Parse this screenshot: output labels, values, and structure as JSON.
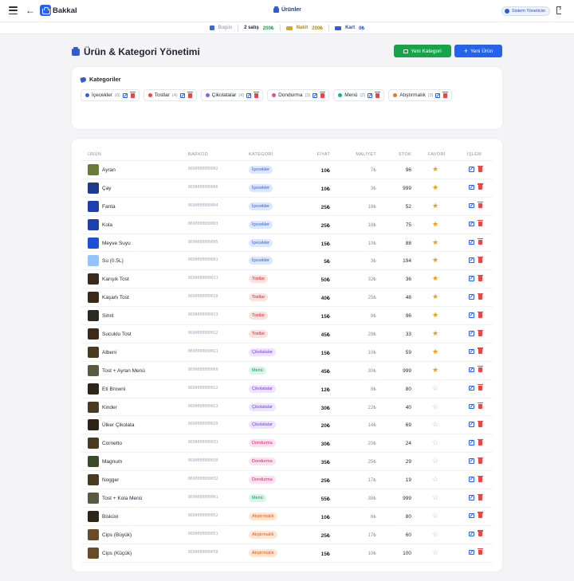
{
  "app": {
    "brand": "Bakkal",
    "section_title": "Ürünler",
    "user_label": "Sistem Yöneticisi"
  },
  "stats": {
    "today_label": "Bugün",
    "sales_count": "2 satış",
    "total": "200₺",
    "cash_label": "Nakit",
    "cash_value": "200₺",
    "card_label": "Kart",
    "card_value": "0₺"
  },
  "page": {
    "title": "Ürün & Kategori Yönetimi",
    "new_category": "Yeni Kategori",
    "new_product": "Yeni Ürün"
  },
  "categories": {
    "title": "Kategoriler",
    "items": [
      {
        "label": "İçecekler",
        "count": "(6)",
        "color": "#2563eb"
      },
      {
        "label": "Tostlar",
        "count": "(4)",
        "color": "#ef4444"
      },
      {
        "label": "Çikolatalar",
        "count": "(4)",
        "color": "#8b5cf6"
      },
      {
        "label": "Dondurma",
        "count": "(3)",
        "color": "#ec4899"
      },
      {
        "label": "Menü",
        "count": "(2)",
        "color": "#10b981"
      },
      {
        "label": "Atıştırmalık",
        "count": "(3)",
        "color": "#f97316"
      }
    ]
  },
  "table": {
    "headers": [
      "ÜRÜN",
      "BARKOD",
      "KATEGORİ",
      "FİYAT",
      "MALİYET",
      "STOK",
      "FAVORİ",
      "İŞLEM"
    ],
    "rows": [
      {
        "name": "Ayran",
        "barcode": "8690000000002",
        "category": "İçecekler",
        "cat": "icecek",
        "price": "10₺",
        "cost": "7₺",
        "stock": "96",
        "fav": true,
        "thumb": "#6b7b3a"
      },
      {
        "name": "Çay",
        "barcode": "8690000000006",
        "category": "İçecekler",
        "cat": "icecek",
        "price": "10₺",
        "cost": "3₺",
        "stock": "999",
        "fav": true,
        "thumb": "#1e3a8a"
      },
      {
        "name": "Fanta",
        "barcode": "8690000000004",
        "category": "İçecekler",
        "cat": "icecek",
        "price": "25₺",
        "cost": "18₺",
        "stock": "52",
        "fav": true,
        "thumb": "#1e40af"
      },
      {
        "name": "Kola",
        "barcode": "8690000000003",
        "category": "İçecekler",
        "cat": "icecek",
        "price": "25₺",
        "cost": "18₺",
        "stock": "75",
        "fav": true,
        "thumb": "#1e40af"
      },
      {
        "name": "Meyve Suyu",
        "barcode": "8690000000005",
        "category": "İçecekler",
        "cat": "icecek",
        "price": "15₺",
        "cost": "10₺",
        "stock": "88",
        "fav": true,
        "thumb": "#1d4ed8"
      },
      {
        "name": "Su (0.5L)",
        "barcode": "8690000000001",
        "category": "İçecekler",
        "cat": "icecek",
        "price": "5₺",
        "cost": "3₺",
        "stock": "194",
        "fav": true,
        "thumb": "#93c5fd"
      },
      {
        "name": "Karışık Tost",
        "barcode": "8690000000011",
        "category": "Tostlar",
        "cat": "tost",
        "price": "50₺",
        "cost": "32₺",
        "stock": "36",
        "fav": true,
        "thumb": "#3b2a1a"
      },
      {
        "name": "Kaşarlı Tost",
        "barcode": "8690000000010",
        "category": "Tostlar",
        "cat": "tost",
        "price": "40₺",
        "cost": "25₺",
        "stock": "48",
        "fav": true,
        "thumb": "#3b2a1a"
      },
      {
        "name": "Simit",
        "barcode": "8690000000013",
        "category": "Tostlar",
        "cat": "tost",
        "price": "15₺",
        "cost": "8₺",
        "stock": "96",
        "fav": true,
        "thumb": "#2a2a22"
      },
      {
        "name": "Sucuklu Tost",
        "barcode": "8690000000012",
        "category": "Tostlar",
        "cat": "tost",
        "price": "45₺",
        "cost": "28₺",
        "stock": "33",
        "fav": true,
        "thumb": "#3b2a1a"
      },
      {
        "name": "Albeni",
        "barcode": "8690000000021",
        "category": "Çikolatalar",
        "cat": "cikolata",
        "price": "15₺",
        "cost": "10₺",
        "stock": "59",
        "fav": true,
        "thumb": "#4a3a22"
      },
      {
        "name": "Tost + Ayran Menü",
        "barcode": "8690000000060",
        "category": "Menü",
        "cat": "menu",
        "price": "45₺",
        "cost": "30₺",
        "stock": "999",
        "fav": true,
        "thumb": "#5a5a40"
      },
      {
        "name": "Eti Browni",
        "barcode": "8690000000022",
        "category": "Çikolatalar",
        "cat": "cikolata",
        "price": "12₺",
        "cost": "8₺",
        "stock": "80",
        "fav": false,
        "thumb": "#2f2418"
      },
      {
        "name": "Kinder",
        "barcode": "8690000000023",
        "category": "Çikolatalar",
        "cat": "cikolata",
        "price": "30₺",
        "cost": "22₺",
        "stock": "40",
        "fav": false,
        "thumb": "#4a3a22"
      },
      {
        "name": "Ülker Çikolata",
        "barcode": "8690000000020",
        "category": "Çikolatalar",
        "cat": "cikolata",
        "price": "20₺",
        "cost": "14₺",
        "stock": "69",
        "fav": false,
        "thumb": "#2f2418"
      },
      {
        "name": "Cornetto",
        "barcode": "8690000000031",
        "category": "Dondurma",
        "cat": "dondurma",
        "price": "30₺",
        "cost": "20₺",
        "stock": "24",
        "fav": false,
        "thumb": "#4a3a22"
      },
      {
        "name": "Magnum",
        "barcode": "8690000000030",
        "category": "Dondurma",
        "cat": "dondurma",
        "price": "35₺",
        "cost": "25₺",
        "stock": "29",
        "fav": false,
        "thumb": "#3b4a2a"
      },
      {
        "name": "Nogger",
        "barcode": "8690000000032",
        "category": "Dondurma",
        "cat": "dondurma",
        "price": "25₺",
        "cost": "17₺",
        "stock": "19",
        "fav": false,
        "thumb": "#4a3a22"
      },
      {
        "name": "Tost + Kola Menü",
        "barcode": "8690000000061",
        "category": "Menü",
        "cat": "menu",
        "price": "55₺",
        "cost": "38₺",
        "stock": "999",
        "fav": false,
        "thumb": "#5a5a40"
      },
      {
        "name": "Bisküvi",
        "barcode": "8690000000052",
        "category": "Atıştırmalık",
        "cat": "atistirmalik",
        "price": "10₺",
        "cost": "6₺",
        "stock": "80",
        "fav": false,
        "thumb": "#2f2418"
      },
      {
        "name": "Cips (Büyük)",
        "barcode": "8690000000051",
        "category": "Atıştırmalık",
        "cat": "atistirmalik",
        "price": "25₺",
        "cost": "17₺",
        "stock": "60",
        "fav": false,
        "thumb": "#6b4a2a"
      },
      {
        "name": "Cips (Küçük)",
        "barcode": "8690000000050",
        "category": "Atıştırmalık",
        "cat": "atistirmalik",
        "price": "15₺",
        "cost": "10₺",
        "stock": "100",
        "fav": false,
        "thumb": "#6b4a2a"
      }
    ]
  },
  "badge_colors": {
    "icecek": {
      "bg": "#dbe7ff",
      "fg": "#2f5bd8"
    },
    "tost": {
      "bg": "#fde0e0",
      "fg": "#dc2626"
    },
    "cikolata": {
      "bg": "#ede4ff",
      "fg": "#7c3aed"
    },
    "dondurma": {
      "bg": "#fce1ef",
      "fg": "#db2777"
    },
    "menu": {
      "bg": "#d9f5e6",
      "fg": "#059669"
    },
    "atistirmalik": {
      "bg": "#ffe6d3",
      "fg": "#ea580c"
    }
  }
}
